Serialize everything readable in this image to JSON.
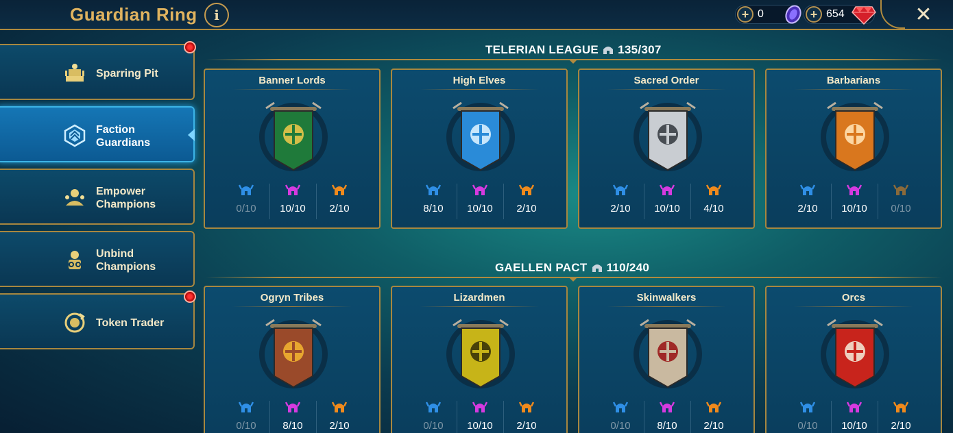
{
  "header": {
    "title": "Guardian Ring",
    "info_icon": "info-icon",
    "currency1_value": "0",
    "currency1_icon": "purple-token-icon",
    "currency2_value": "654",
    "currency2_icon": "ruby-gem-icon",
    "close_icon": "close-icon"
  },
  "sidebar": {
    "items": [
      {
        "label_line1": "Sparring Pit",
        "label_line2": "",
        "icon": "sparring-pit-icon",
        "notification": true,
        "active": false
      },
      {
        "label_line1": "Faction",
        "label_line2": "Guardians",
        "icon": "faction-guardians-icon",
        "notification": false,
        "active": true
      },
      {
        "label_line1": "Empower",
        "label_line2": "Champions",
        "icon": "empower-champions-icon",
        "notification": false,
        "active": false
      },
      {
        "label_line1": "Unbind",
        "label_line2": "Champions",
        "icon": "unbind-champions-icon",
        "notification": false,
        "active": false
      },
      {
        "label_line1": "Token Trader",
        "label_line2": "",
        "icon": "token-trader-icon",
        "notification": true,
        "active": false
      }
    ]
  },
  "colors": {
    "rare": "#2f8fe6",
    "epic": "#d63ae0",
    "legendary": "#f08a1c",
    "gold": "#b08a3e"
  },
  "leagues": [
    {
      "name": "TELERIAN LEAGUE",
      "progress": "135/307",
      "factions": [
        {
          "name": "Banner Lords",
          "banner": "banner-lords-emblem",
          "rare": "0/10",
          "epic": "10/10",
          "legendary": "2/10",
          "dim": [
            true,
            false,
            false
          ]
        },
        {
          "name": "High Elves",
          "banner": "high-elves-emblem",
          "rare": "8/10",
          "epic": "10/10",
          "legendary": "2/10",
          "dim": [
            false,
            false,
            false
          ]
        },
        {
          "name": "Sacred Order",
          "banner": "sacred-order-emblem",
          "rare": "2/10",
          "epic": "10/10",
          "legendary": "4/10",
          "dim": [
            false,
            false,
            false
          ]
        },
        {
          "name": "Barbarians",
          "banner": "barbarians-emblem",
          "rare": "2/10",
          "epic": "10/10",
          "legendary": "0/10",
          "dim": [
            false,
            false,
            true
          ]
        }
      ]
    },
    {
      "name": "GAELLEN PACT",
      "progress": "110/240",
      "factions": [
        {
          "name": "Ogryn Tribes",
          "banner": "ogryn-tribes-emblem",
          "rare": "0/10",
          "epic": "8/10",
          "legendary": "2/10",
          "dim": [
            true,
            false,
            false
          ]
        },
        {
          "name": "Lizardmen",
          "banner": "lizardmen-emblem",
          "rare": "0/10",
          "epic": "10/10",
          "legendary": "2/10",
          "dim": [
            true,
            false,
            false
          ]
        },
        {
          "name": "Skinwalkers",
          "banner": "skinwalkers-emblem",
          "rare": "0/10",
          "epic": "8/10",
          "legendary": "2/10",
          "dim": [
            true,
            false,
            false
          ]
        },
        {
          "name": "Orcs",
          "banner": "orcs-emblem",
          "rare": "0/10",
          "epic": "10/10",
          "legendary": "2/10",
          "dim": [
            true,
            false,
            false
          ]
        }
      ]
    }
  ]
}
